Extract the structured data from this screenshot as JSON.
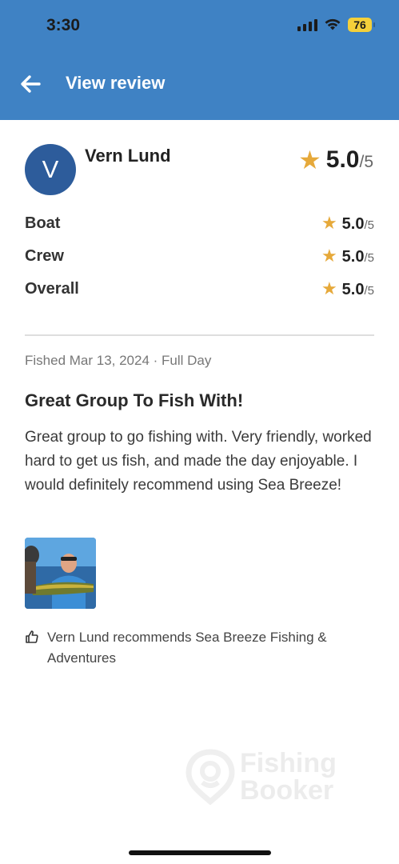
{
  "status": {
    "time": "3:30",
    "battery": "76"
  },
  "header": {
    "title": "View review"
  },
  "reviewer": {
    "initial": "V",
    "name": "Vern Lund",
    "score": "5.0",
    "score_max": "/5"
  },
  "ratings": [
    {
      "label": "Boat",
      "value": "5.0",
      "max": "/5"
    },
    {
      "label": "Crew",
      "value": "5.0",
      "max": "/5"
    },
    {
      "label": "Overall",
      "value": "5.0",
      "max": "/5"
    }
  ],
  "review": {
    "fished_info": "Fished Mar 13, 2024 · Full Day",
    "title": "Great Group To Fish With!",
    "body": "Great group to go fishing with. Very friendly, worked hard to get us fish, and made the day enjoyable. I would definitely recommend using Sea Breeze!",
    "recommendation": "Vern Lund recommends Sea Breeze Fishing & Adventures"
  },
  "watermark": {
    "line1": "Fishing",
    "line2": "Booker"
  },
  "icons": {
    "back": "arrow-left-icon",
    "star": "star-icon",
    "thumb": "thumbs-up-icon",
    "signal": "cellular-signal-icon",
    "wifi": "wifi-icon",
    "battery": "battery-icon"
  },
  "colors": {
    "header": "#3f82c4",
    "avatar": "#2d5c9b",
    "star": "#e6a93a",
    "battery": "#f4d03a"
  }
}
